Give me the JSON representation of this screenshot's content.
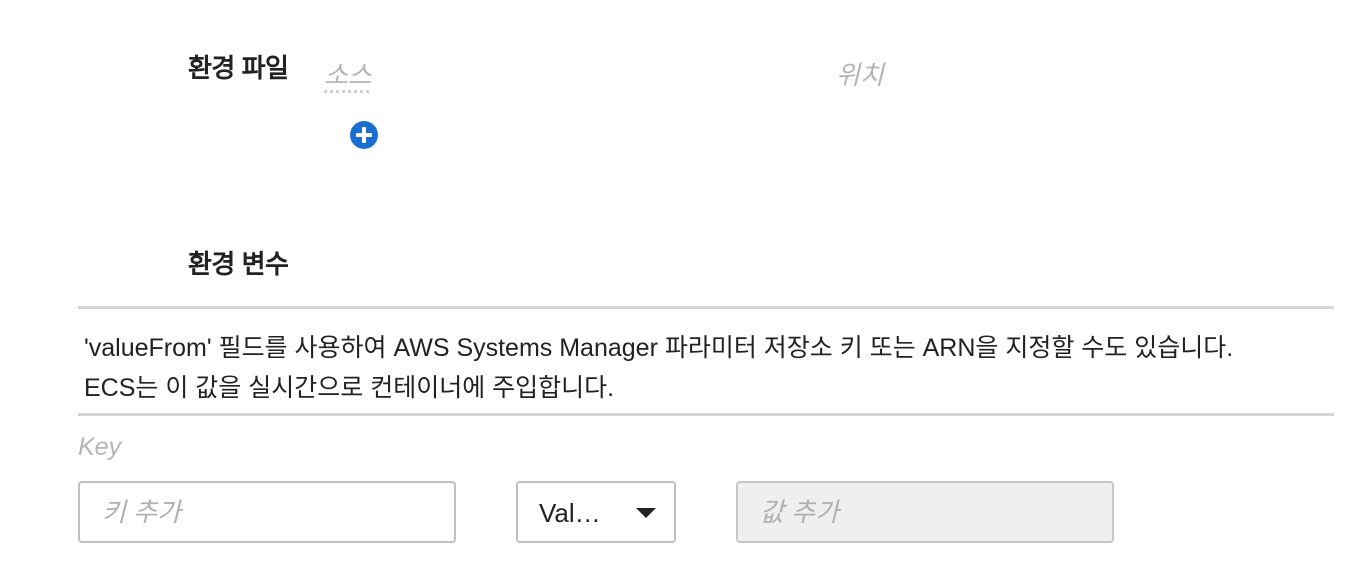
{
  "env_files": {
    "label": "환경 파일",
    "col_source": "소스",
    "col_location": "위치",
    "add_icon": "plus-circle-icon"
  },
  "env_vars": {
    "label": "환경 변수",
    "info_line1": "'valueFrom' 필드를 사용하여 AWS Systems Manager 파라미터 저장소 키 또는 ARN을 지정할 수도 있습니다.",
    "info_line2": "ECS는 이 값을 실시간으로 컨테이너에 주입합니다.",
    "key_header": "Key",
    "key_placeholder": "키 추가",
    "value_type_selected": "Val…",
    "value_placeholder": "값 추가"
  },
  "colors": {
    "accent": "#1a6fd0",
    "divider": "#d5d5d5",
    "placeholder": "#b0b0b0"
  }
}
